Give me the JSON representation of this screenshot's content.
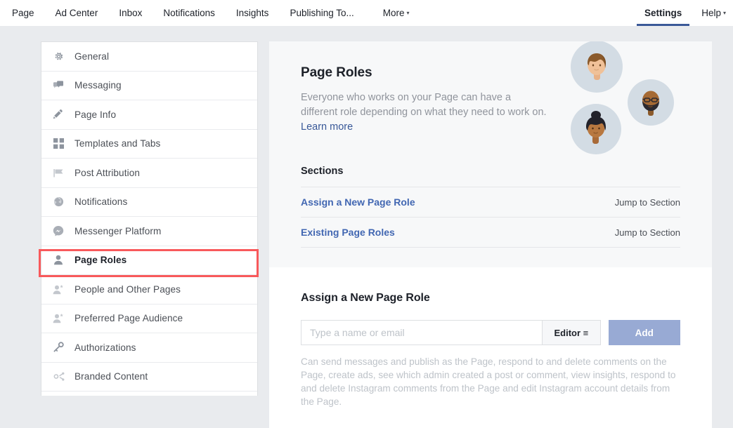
{
  "topnav": {
    "left_items": [
      {
        "label": "Page",
        "icon": "none"
      },
      {
        "label": "Ad Center",
        "icon": "none"
      },
      {
        "label": "Inbox",
        "icon": "none"
      },
      {
        "label": "Notifications",
        "icon": "none"
      },
      {
        "label": "Insights",
        "icon": "none"
      },
      {
        "label": "Publishing To...",
        "icon": "none"
      }
    ],
    "more_label": "More",
    "settings_label": "Settings",
    "help_label": "Help",
    "caret": "▾",
    "accent_color": "#3b5998"
  },
  "sidebar": {
    "items": [
      {
        "label": "General",
        "icon": "gear-icon",
        "selected": false
      },
      {
        "label": "Messaging",
        "icon": "chat-bubbles-icon",
        "selected": false
      },
      {
        "label": "Page Info",
        "icon": "pencil-icon",
        "selected": false
      },
      {
        "label": "Templates and Tabs",
        "icon": "grid-icon",
        "selected": false
      },
      {
        "label": "Post Attribution",
        "icon": "flag-icon",
        "selected": false
      },
      {
        "label": "Notifications",
        "icon": "globe-icon",
        "selected": false
      },
      {
        "label": "Messenger Platform",
        "icon": "messenger-icon",
        "selected": false
      },
      {
        "label": "Page Roles",
        "icon": "person-icon",
        "selected": true
      },
      {
        "label": "People and Other Pages",
        "icon": "person-star-icon",
        "selected": false
      },
      {
        "label": "Preferred Page Audience",
        "icon": "person-star-icon",
        "selected": false
      },
      {
        "label": "Authorizations",
        "icon": "key-icon",
        "selected": false
      },
      {
        "label": "Branded Content",
        "icon": "branded-content-icon",
        "selected": false
      }
    ],
    "highlight_color": "#f8595b"
  },
  "hero": {
    "title": "Page Roles",
    "description": "Everyone who works on your Page can have a different role depending on what they need to work on. ",
    "learn_more_label": "Learn more",
    "avatars": [
      {
        "name": "avatar-person-1"
      },
      {
        "name": "avatar-person-2"
      },
      {
        "name": "avatar-person-3"
      }
    ]
  },
  "sections": {
    "heading": "Sections",
    "rows": [
      {
        "name": "Assign a New Page Role",
        "jump_label": "Jump to Section"
      },
      {
        "name": "Existing Page Roles",
        "jump_label": "Jump to Section"
      }
    ]
  },
  "assign": {
    "title": "Assign a New Page Role",
    "input_placeholder": "Type a name or email",
    "input_value": "",
    "role_selected": "Editor ≡",
    "add_label": "Add",
    "description": "Can send messages and publish as the Page, respond to and delete comments on the Page, create ads, see which admin created a post or comment, view insights, respond to and delete Instagram comments from the Page and edit Instagram account details from the Page."
  }
}
